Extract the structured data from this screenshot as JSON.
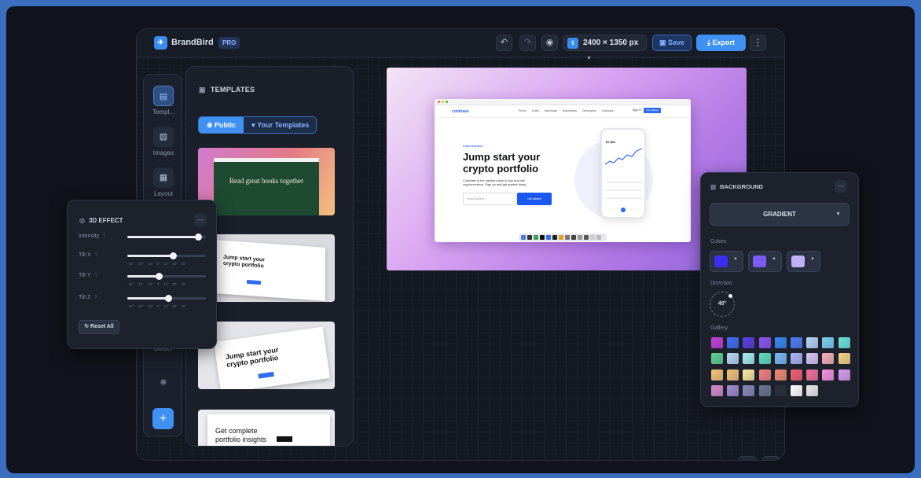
{
  "app": {
    "brand": "BrandBird",
    "badge": "PRO",
    "canvas_size": "2400 × 1350 px",
    "save_label": "Save",
    "export_label": "Export"
  },
  "icons": {
    "undo": "undo-icon",
    "redo": "redo-icon",
    "preview": "eye-icon",
    "twitter": "twitter-icon",
    "more": "more-icon",
    "keyboard": "keyboard-icon",
    "help": "help-icon"
  },
  "sidebar": {
    "items": [
      {
        "label": "Templ...",
        "icon": "templates-icon",
        "active": true
      },
      {
        "label": "Images",
        "icon": "image-icon",
        "active": false
      },
      {
        "label": "Layout",
        "icon": "layout-icon",
        "active": false
      },
      {
        "label": "Border",
        "icon": "border-icon",
        "active": false
      }
    ]
  },
  "templates": {
    "title": "TEMPLATES",
    "tab_public": "Public",
    "tab_yours": "Your Templates",
    "thumbs": [
      {
        "headline": "Read great books together"
      },
      {
        "headline": "Jump start your crypto portfolio"
      },
      {
        "headline": "Jump start your crypto portfolio"
      },
      {
        "headline": "Get complete portfolio insights"
      }
    ]
  },
  "preview": {
    "site_logo": "coinbase",
    "nav_links": "Prices Learn Individuals Businesses Developers Company",
    "sign_in": "Sign in",
    "get_started": "Get started",
    "pill": "Learn and earn",
    "headline": "Jump start your crypto portfolio",
    "subtext": "Coinbase is the easiest place to buy and sell cryptocurrency. Sign up and get started today.",
    "email_placeholder": "Email address",
    "cta": "Get started",
    "balance": "$7,901"
  },
  "fx": {
    "title": "3D EFFECT",
    "sliders": [
      {
        "label": "Intensity",
        "value": 0.9,
        "ticks": ""
      },
      {
        "label": "Tilt X",
        "value": 0.58,
        "ticks": "-45° -30° -15° 0° 15° 30° 45°"
      },
      {
        "label": "Tilt Y",
        "value": 0.4,
        "ticks": "-45° -30° -15° 0° 15° 30° 45°"
      },
      {
        "label": "Tilt Z",
        "value": 0.52,
        "ticks": "-45° -30° -15° 0° 15° 30° 45°"
      }
    ],
    "reset_label": "Reset All"
  },
  "background": {
    "title": "BACKGROUND",
    "mode": "GRADIENT",
    "colors_label": "Colors",
    "colors": [
      "#3a2ef0",
      "#7a5cf4",
      "#bfb0f7"
    ],
    "direction_label": "Direction",
    "direction": "45°",
    "gallery_label": "Gallery",
    "gallery": [
      [
        "#c23fd9",
        "#3f6ef0",
        "#5a3fe0",
        "#8a55f0",
        "#3b86f0",
        "#4d7cf5",
        "#b5d4f5",
        "#7ad0f0",
        "#6be0d8"
      ],
      [
        "#5fd08f",
        "#b9d6f3",
        "#a7ecf0",
        "#5fdcc0",
        "#7ab8f5",
        "#a9b4f7",
        "#d3c5f5",
        "#f5b0b8",
        "#f5d08a"
      ],
      [
        "#f5c27a",
        "#f0c27a",
        "#f7e7a0",
        "#f08080",
        "#f08a70",
        "#f06070",
        "#f07098",
        "#f590e0",
        "#d79af0"
      ],
      [
        "#d688c8",
        "#a08ad0",
        "#8888b8",
        "#6a7590",
        "#2a2f3a",
        "#ffffff",
        "#e8e8e8"
      ]
    ]
  }
}
